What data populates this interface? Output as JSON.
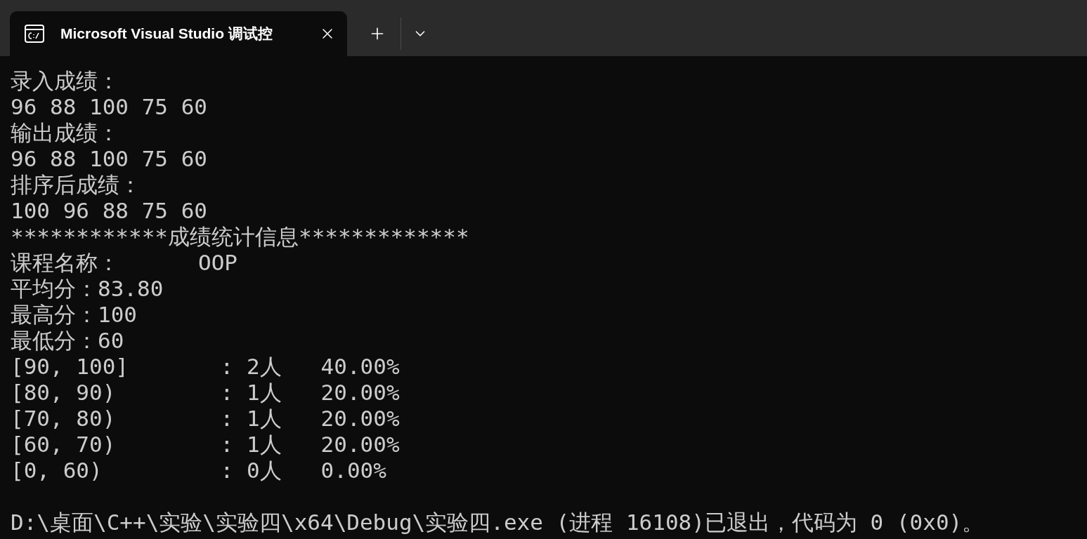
{
  "tab": {
    "title": "Microsoft Visual Studio 调试控",
    "selected": true
  },
  "console": {
    "lines": [
      "录入成绩：",
      "96 88 100 75 60",
      "输出成绩：",
      "96 88 100 75 60",
      "排序后成绩：",
      "100 96 88 75 60",
      "************成绩统计信息*************",
      "课程名称：      OOP",
      "平均分：83.80",
      "最高分：100",
      "最低分：60",
      "[90, 100]       : 2人   40.00%",
      "[80, 90)        : 1人   20.00%",
      "[70, 80)        : 1人   20.00%",
      "[60, 70)        : 1人   20.00%",
      "[0, 60)         : 0人   0.00%"
    ],
    "exit_message": "D:\\桌面\\C++\\实验\\实验四\\x64\\Debug\\实验四.exe (进程 16108)已退出，代码为 0 (0x0)。"
  }
}
